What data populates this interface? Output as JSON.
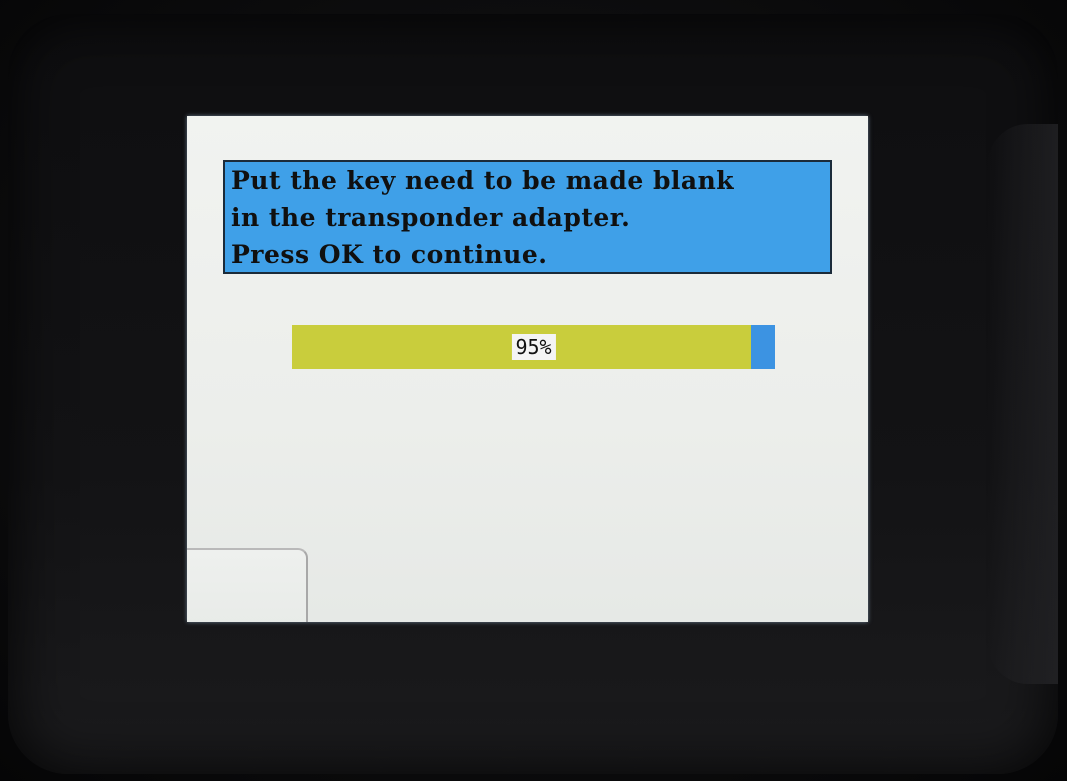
{
  "device": {
    "screen": {
      "message": {
        "lines": [
          "Put the key need to be made blank",
          "in the transponder adapter.",
          "Press OK to continue."
        ]
      },
      "progress": {
        "value_percent": 95,
        "label": "95%",
        "fill_color": "#c9cd3c",
        "remainder_color": "#3c93e2"
      },
      "message_box_color": "#3fa0e8"
    }
  }
}
